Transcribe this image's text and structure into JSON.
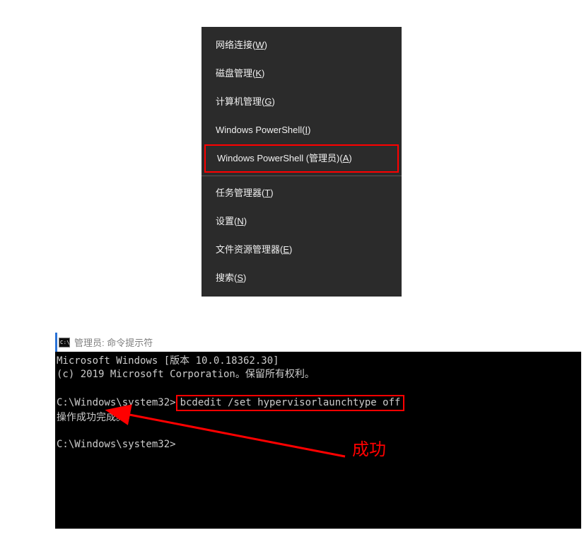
{
  "context_menu": {
    "items": [
      {
        "label": "网络连接(",
        "hotkey": "W",
        "suffix": ")",
        "highlighted": false
      },
      {
        "label": "磁盘管理(",
        "hotkey": "K",
        "suffix": ")",
        "highlighted": false
      },
      {
        "label": "计算机管理(",
        "hotkey": "G",
        "suffix": ")",
        "highlighted": false
      },
      {
        "label": "Windows PowerShell(",
        "hotkey": "I",
        "suffix": ")",
        "highlighted": false
      },
      {
        "label": "Windows PowerShell (管理员)(",
        "hotkey": "A",
        "suffix": ")",
        "highlighted": true,
        "divider_after": true
      },
      {
        "label": "任务管理器(",
        "hotkey": "T",
        "suffix": ")",
        "highlighted": false
      },
      {
        "label": "设置(",
        "hotkey": "N",
        "suffix": ")",
        "highlighted": false
      },
      {
        "label": "文件资源管理器(",
        "hotkey": "E",
        "suffix": ")",
        "highlighted": false
      },
      {
        "label": "搜索(",
        "hotkey": "S",
        "suffix": ")",
        "highlighted": false
      }
    ]
  },
  "console": {
    "icon_text": "C:\\.",
    "title": "管理员: 命令提示符",
    "line1": "Microsoft Windows [版本 10.0.18362.30]",
    "line2": "(c) 2019 Microsoft Corporation。保留所有权利。",
    "prompt1_prefix": "C:\\Windows\\system32>",
    "command1": "bcdedit /set hypervisorlaunchtype off",
    "result": "操作成功完成。",
    "prompt2": "C:\\Windows\\system32>",
    "annotation": "成功"
  }
}
